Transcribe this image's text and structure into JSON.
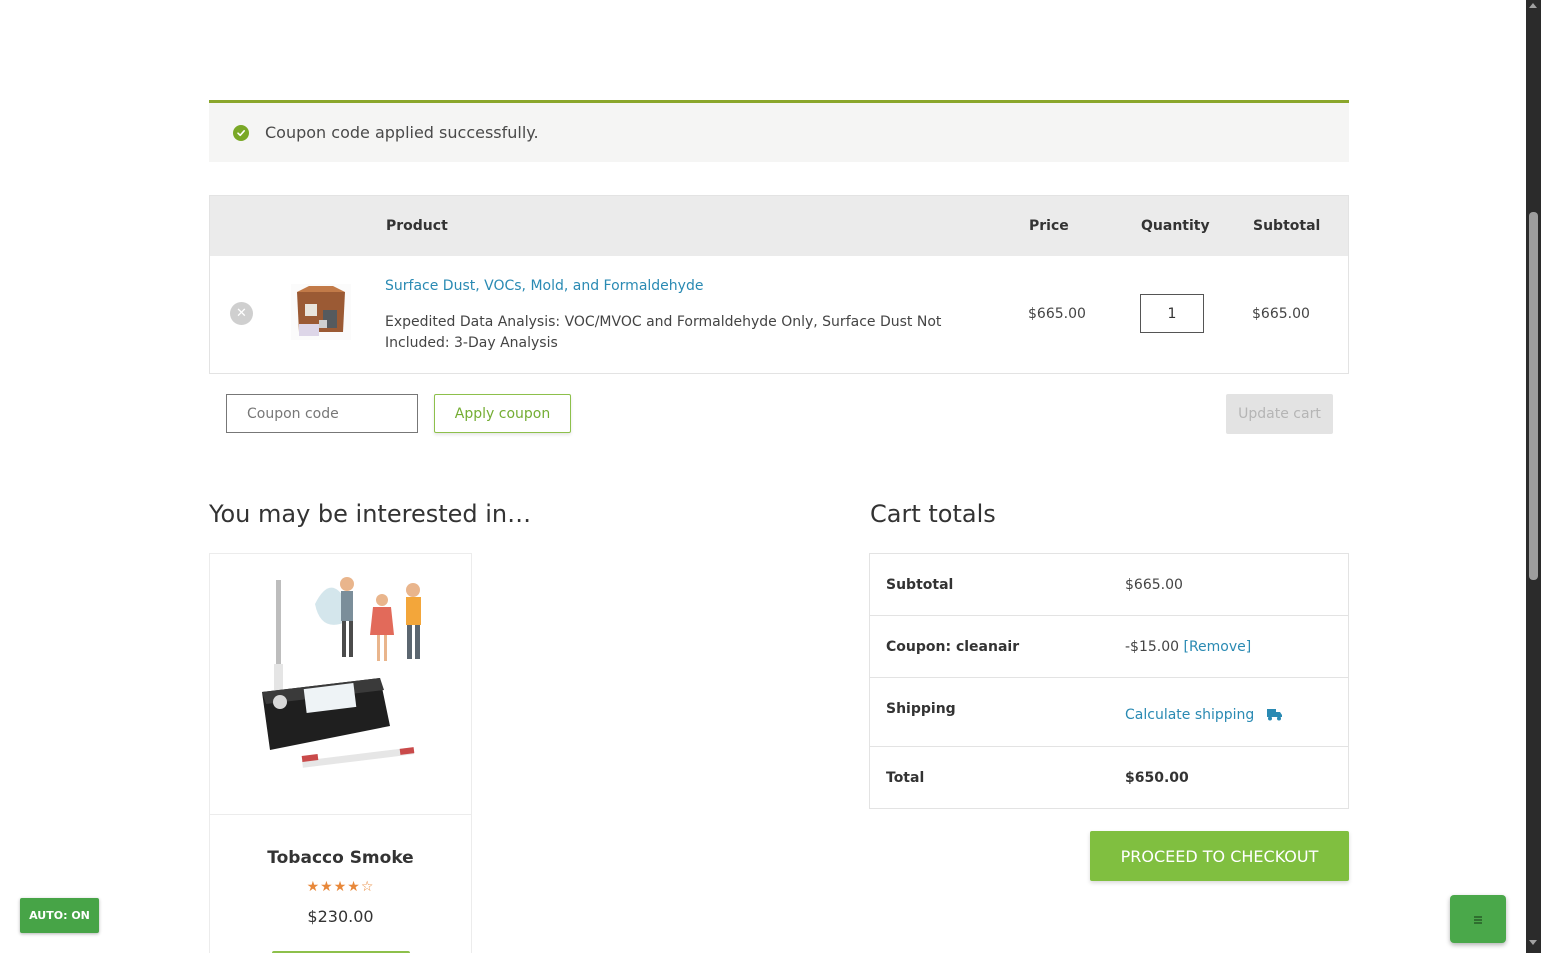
{
  "notice": {
    "message": "Coupon code applied successfully.",
    "icon": "check-circle-icon",
    "color": "#8aa62b"
  },
  "cart_table": {
    "headers": {
      "product": "Product",
      "price": "Price",
      "quantity": "Quantity",
      "subtotal": "Subtotal"
    },
    "items": [
      {
        "name": "Surface Dust, VOCs, Mold, and Formaldehyde",
        "meta": "Expedited Data Analysis: VOC/MVOC and Formaldehyde Only, Surface Dust Not Included: 3-Day Analysis",
        "price": "$665.00",
        "quantity": "1",
        "subtotal": "$665.00",
        "remove_icon": "close-icon"
      }
    ]
  },
  "coupon": {
    "placeholder": "Coupon code",
    "apply_label": "Apply coupon",
    "update_label": "Update cart"
  },
  "interested": {
    "title": "You may be interested in…",
    "products": [
      {
        "name": "Tobacco Smoke",
        "rating": 4,
        "rating_max": 5,
        "stars": "★★★★☆",
        "price": "$230.00"
      }
    ]
  },
  "totals": {
    "title": "Cart totals",
    "subtotal_label": "Subtotal",
    "subtotal_value": "$665.00",
    "coupon_label": "Coupon: cleanair",
    "coupon_value": "-$15.00",
    "coupon_remove": "[Remove]",
    "shipping_label": "Shipping",
    "shipping_link": "Calculate shipping",
    "shipping_icon": "truck-icon",
    "total_label": "Total",
    "total_value": "$650.00"
  },
  "checkout": {
    "label": "PROCEED TO CHECKOUT",
    "color": "#80bf40"
  },
  "auto_badge": {
    "label": "AUTO: ON"
  }
}
